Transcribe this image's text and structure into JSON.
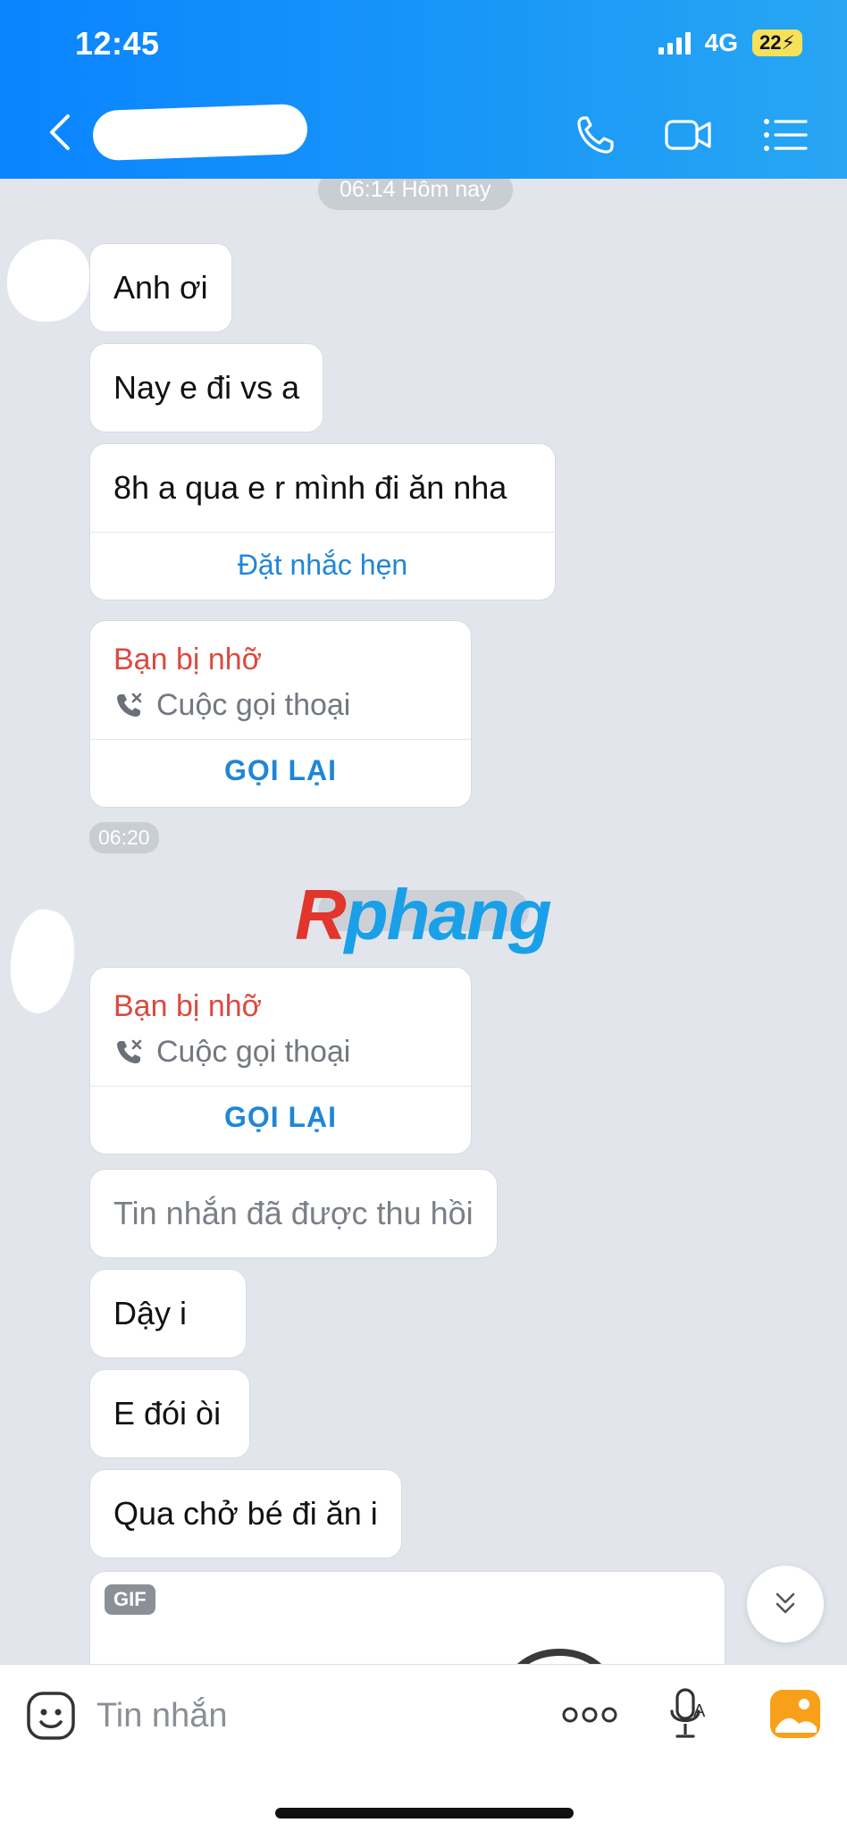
{
  "status_bar": {
    "time": "12:45",
    "network": "4G",
    "battery": "22"
  },
  "header": {
    "contact_name": ""
  },
  "chat": {
    "date_pill_1": "06:14 Hôm nay",
    "messages_1": [
      {
        "text": "Anh ơi"
      },
      {
        "text": "Nay e đi vs a"
      },
      {
        "text": "8h a qua e r mình đi ăn nha",
        "action": "Đặt nhắc hẹn"
      }
    ],
    "missed_call_1": {
      "title": "Bạn bị nhỡ",
      "subtitle": "Cuộc gọi thoại",
      "action": "GỌI LẠI"
    },
    "time_1": "06:20",
    "watermark": {
      "first": "R",
      "rest": "phang"
    },
    "missed_call_2": {
      "title": "Bạn bị nhỡ",
      "subtitle": "Cuộc gọi thoại",
      "action": "GỌI LẠI"
    },
    "recalled": "Tin nhắn đã được thu hồi",
    "messages_2": [
      {
        "text": "Dậy i"
      },
      {
        "text": "E đói òi"
      },
      {
        "text": "Qua chở bé đi ăn i"
      }
    ],
    "gif_badge": "GIF"
  },
  "input_bar": {
    "placeholder": "Tin nhắn"
  },
  "colors": {
    "header": "#1a98f7",
    "missed": "#db4a3f",
    "link": "#1f86d8"
  }
}
